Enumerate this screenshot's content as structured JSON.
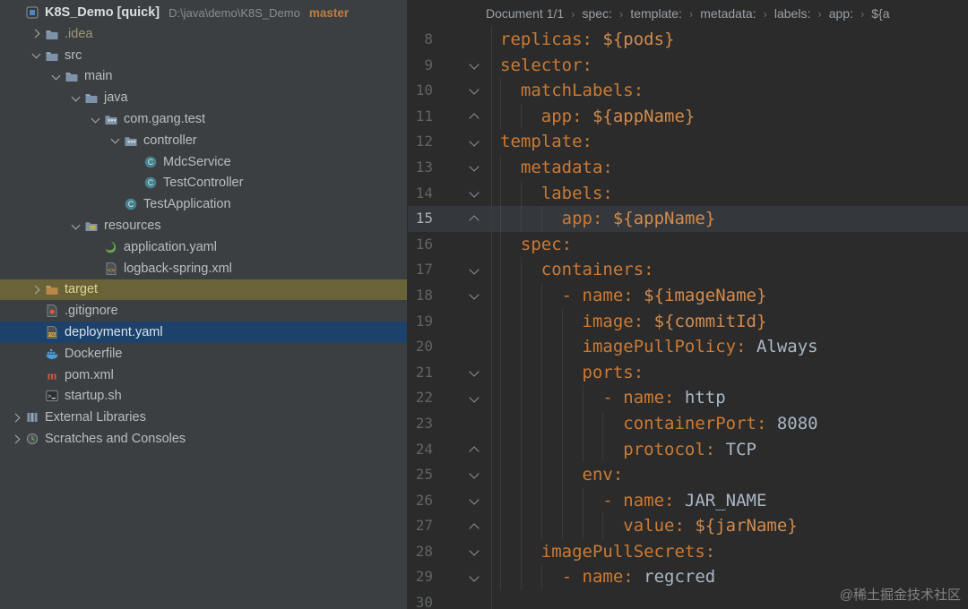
{
  "tree": {
    "header": {
      "title": "K8S_Demo [quick]",
      "path": "D:\\java\\demo\\K8S_Demo",
      "branch": "master"
    },
    "rows": [
      {
        "level": 1,
        "chevron": "right",
        "icon": "folder",
        "label": ".idea",
        "tone": "excluded"
      },
      {
        "level": 1,
        "chevron": "down",
        "icon": "folder",
        "label": "src"
      },
      {
        "level": 2,
        "chevron": "down",
        "icon": "folder",
        "label": "main"
      },
      {
        "level": 3,
        "chevron": "down",
        "icon": "folder",
        "label": "java"
      },
      {
        "level": 4,
        "chevron": "down",
        "icon": "package",
        "label": "com.gang.test"
      },
      {
        "level": 5,
        "chevron": "down",
        "icon": "package",
        "label": "controller"
      },
      {
        "level": 6,
        "chevron": "",
        "icon": "class",
        "label": "MdcService"
      },
      {
        "level": 6,
        "chevron": "",
        "icon": "class",
        "label": "TestController"
      },
      {
        "level": 5,
        "chevron": "",
        "icon": "class",
        "label": "TestApplication"
      },
      {
        "level": 3,
        "chevron": "down",
        "icon": "resources",
        "label": "resources"
      },
      {
        "level": 4,
        "chevron": "",
        "icon": "spring",
        "label": "application.yaml"
      },
      {
        "level": 4,
        "chevron": "",
        "icon": "xml",
        "label": "logback-spring.xml"
      },
      {
        "level": 1,
        "chevron": "right",
        "icon": "folder-excluded",
        "label": "target",
        "highlight": "target"
      },
      {
        "level": 1,
        "chevron": "",
        "icon": "gitignore",
        "label": ".gitignore"
      },
      {
        "level": 1,
        "chevron": "",
        "icon": "yaml",
        "label": "deployment.yaml",
        "highlight": "selected"
      },
      {
        "level": 1,
        "chevron": "",
        "icon": "docker",
        "label": "Dockerfile"
      },
      {
        "level": 1,
        "chevron": "",
        "icon": "maven",
        "label": "pom.xml"
      },
      {
        "level": 1,
        "chevron": "",
        "icon": "shell",
        "label": "startup.sh"
      },
      {
        "level": 0,
        "chevron": "right",
        "icon": "libraries",
        "label": "External Libraries"
      },
      {
        "level": 0,
        "chevron": "right",
        "icon": "scratches",
        "label": "Scratches and Consoles"
      }
    ]
  },
  "breadcrumbs": {
    "items": [
      "Document 1/1",
      "spec:",
      "template:",
      "metadata:",
      "labels:",
      "app:",
      "${a"
    ],
    "separator": "›"
  },
  "editor": {
    "active_line": 15,
    "lines": [
      {
        "num": 8,
        "fold": "",
        "indent": 0,
        "dash": false,
        "key": "replicas:",
        "value": "${pods}",
        "vstyle": "var"
      },
      {
        "num": 9,
        "fold": "start",
        "indent": 0,
        "dash": false,
        "key": "selector:",
        "value": "",
        "vstyle": ""
      },
      {
        "num": 10,
        "fold": "start",
        "indent": 2,
        "dash": false,
        "key": "matchLabels:",
        "value": "",
        "vstyle": ""
      },
      {
        "num": 11,
        "fold": "end",
        "indent": 4,
        "dash": false,
        "key": "app:",
        "value": "${appName}",
        "vstyle": "var"
      },
      {
        "num": 12,
        "fold": "start",
        "indent": 0,
        "dash": false,
        "key": "template:",
        "value": "",
        "vstyle": ""
      },
      {
        "num": 13,
        "fold": "start",
        "indent": 2,
        "dash": false,
        "key": "metadata:",
        "value": "",
        "vstyle": ""
      },
      {
        "num": 14,
        "fold": "start",
        "indent": 4,
        "dash": false,
        "key": "labels:",
        "value": "",
        "vstyle": ""
      },
      {
        "num": 15,
        "fold": "end",
        "indent": 6,
        "dash": false,
        "key": "app:",
        "value": "${appName}",
        "vstyle": "var"
      },
      {
        "num": 16,
        "fold": "",
        "indent": 2,
        "dash": false,
        "key": "spec:",
        "value": "",
        "vstyle": ""
      },
      {
        "num": 17,
        "fold": "start",
        "indent": 4,
        "dash": false,
        "key": "containers:",
        "value": "",
        "vstyle": ""
      },
      {
        "num": 18,
        "fold": "start",
        "indent": 6,
        "dash": true,
        "key": "name:",
        "value": "${imageName}",
        "vstyle": "var"
      },
      {
        "num": 19,
        "fold": "",
        "indent": 8,
        "dash": false,
        "key": "image:",
        "value": "${commitId}",
        "vstyle": "var"
      },
      {
        "num": 20,
        "fold": "",
        "indent": 8,
        "dash": false,
        "key": "imagePullPolicy:",
        "value": "Always",
        "vstyle": "plain"
      },
      {
        "num": 21,
        "fold": "start",
        "indent": 8,
        "dash": false,
        "key": "ports:",
        "value": "",
        "vstyle": ""
      },
      {
        "num": 22,
        "fold": "start",
        "indent": 10,
        "dash": true,
        "key": "name:",
        "value": "http",
        "vstyle": "plain"
      },
      {
        "num": 23,
        "fold": "",
        "indent": 12,
        "dash": false,
        "key": "containerPort:",
        "value": "8080",
        "vstyle": "plain"
      },
      {
        "num": 24,
        "fold": "end",
        "indent": 12,
        "dash": false,
        "key": "protocol:",
        "value": "TCP",
        "vstyle": "plain"
      },
      {
        "num": 25,
        "fold": "start",
        "indent": 8,
        "dash": false,
        "key": "env:",
        "value": "",
        "vstyle": ""
      },
      {
        "num": 26,
        "fold": "start",
        "indent": 10,
        "dash": true,
        "key": "name:",
        "value": "JAR_NAME",
        "vstyle": "plain"
      },
      {
        "num": 27,
        "fold": "end",
        "indent": 12,
        "dash": false,
        "key": "value:",
        "value": "${jarName}",
        "vstyle": "var"
      },
      {
        "num": 28,
        "fold": "start",
        "indent": 4,
        "dash": false,
        "key": "imagePullSecrets:",
        "value": "",
        "vstyle": ""
      },
      {
        "num": 29,
        "fold": "start",
        "indent": 6,
        "dash": true,
        "key": "name:",
        "value": "regcred",
        "vstyle": "plain"
      },
      {
        "num": 30,
        "fold": "",
        "indent": 0,
        "dash": false,
        "key": "",
        "value": "",
        "vstyle": ""
      }
    ]
  },
  "watermark": "@稀土掘金技术社区",
  "colors": {
    "editor_bg": "#2b2b2b",
    "tree_bg": "#3c3f41",
    "key": "#cb7a33",
    "variable": "#d28b4e",
    "plain_value": "#a9b7c6",
    "line_number": "#606366",
    "active_line_bg": "#34373b",
    "selected_row_bg": "#1c426b",
    "selected_row_fg": "#d8e2ec",
    "target_row_bg": "#6b6338",
    "target_row_fg": "#ded791",
    "branch": "#c07e3e",
    "tree_fg": "#b9bec3",
    "excluded_fg": "#9d9878",
    "breadcrumb_fg": "#9aa0a6",
    "watermark_fg": "#9a9a9a"
  }
}
